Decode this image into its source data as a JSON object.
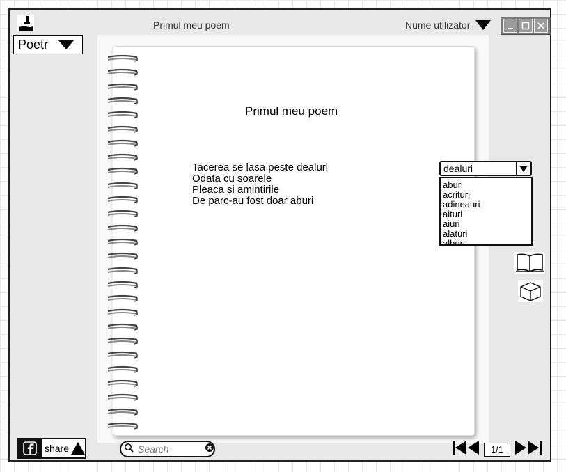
{
  "header": {
    "document_title": "Primul meu poem",
    "user_menu_label": "Nume utilizator"
  },
  "genre_select": {
    "selected": "Poetr"
  },
  "poem": {
    "title": "Primul meu poem",
    "lines": [
      "Tacerea se lasa peste dealuri",
      "Odata cu soarele",
      "Pleaca si amintirile",
      "De parc-au fost doar aburi"
    ]
  },
  "rhyme_dropdown": {
    "selected": "dealuri",
    "options": [
      "aburi",
      "acrituri",
      "adineauri",
      "aituri",
      "aiuri",
      "alaturi",
      "alburi"
    ]
  },
  "share": {
    "label": "share"
  },
  "search": {
    "placeholder": "Search"
  },
  "pagination": {
    "indicator": "1/1"
  },
  "icons": {
    "logo": "writer-logo-icon",
    "read": "open-book-icon",
    "view3d": "cube-icon"
  }
}
